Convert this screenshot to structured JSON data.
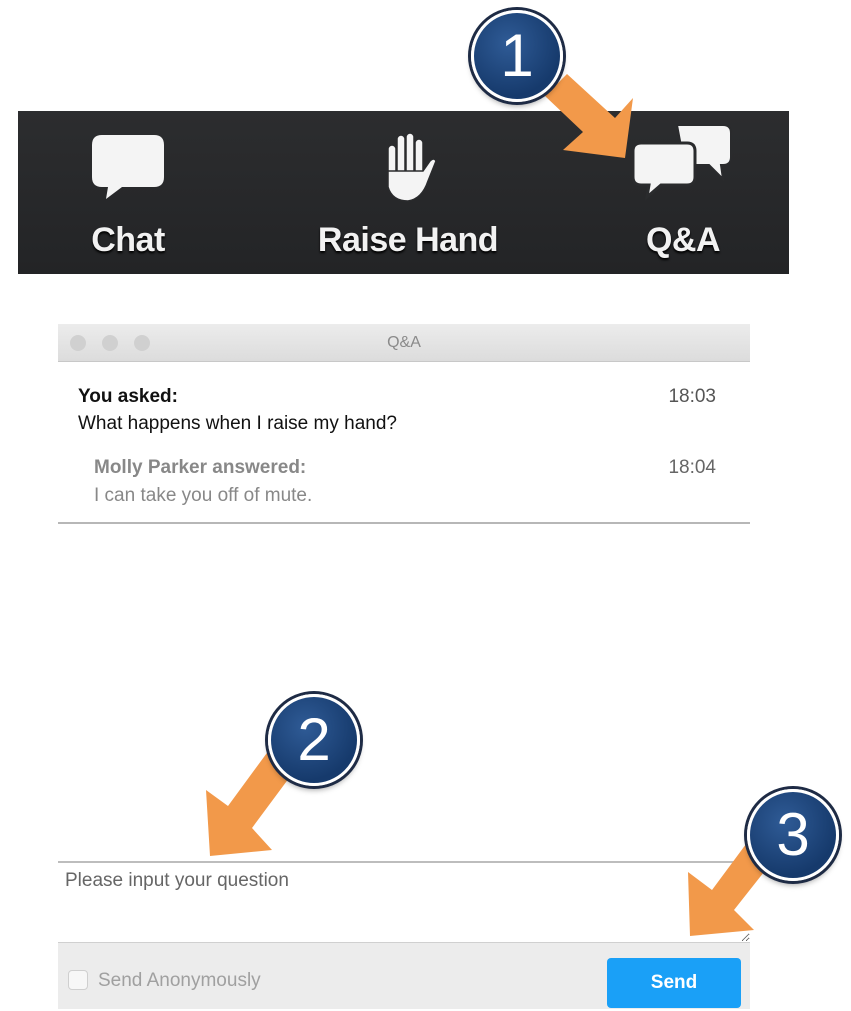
{
  "toolbar": {
    "chat_label": "Chat",
    "raise_hand_label": "Raise Hand",
    "qa_label": "Q&A"
  },
  "window": {
    "title": "Q&A"
  },
  "messages": {
    "question_author": "You asked:",
    "question_time": "18:03",
    "question_text": "What happens when I raise my hand?",
    "answer_author": "Molly Parker answered:",
    "answer_time": "18:04",
    "answer_text": "I can take you off of mute."
  },
  "input": {
    "placeholder": "Please input your question",
    "value": ""
  },
  "footer": {
    "anonymous_label": "Send Anonymously",
    "anonymous_checked": false,
    "send_label": "Send"
  },
  "steps": [
    "1",
    "2",
    "3"
  ],
  "colors": {
    "toolbar_bg": "#2a2b2d",
    "send_button": "#1aa0f7",
    "badge": "#1f4a80",
    "arrow": "#f2994a"
  },
  "icons": {
    "chat": "chat-bubble-icon",
    "raise_hand": "hand-icon",
    "qa": "qa-bubbles-icon"
  }
}
